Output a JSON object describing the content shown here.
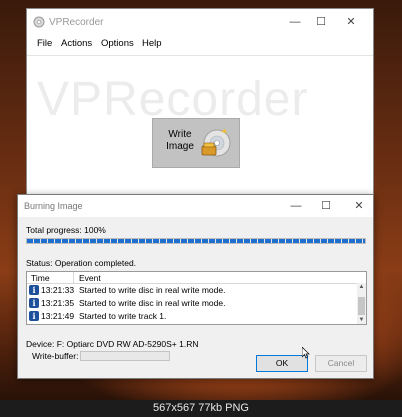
{
  "app": {
    "title": "VPRecorder",
    "watermark": "VPRecorder"
  },
  "menu": [
    "File",
    "Actions",
    "Options",
    "Help"
  ],
  "main": {
    "write_image_label": "Write Image"
  },
  "dialog": {
    "title": "Burning Image",
    "total_progress_label": "Total progress: 100%",
    "progress_fraction": 1.0,
    "status": "Status: Operation completed.",
    "log_columns": {
      "time": "Time",
      "event": "Event"
    },
    "log_rows": [
      {
        "time": "13:21:33",
        "event": "Started to write disc in real write mode."
      },
      {
        "time": "13:21:35",
        "event": "Started to write disc in real write mode."
      },
      {
        "time": "13:21:49",
        "event": "Started to write track 1."
      }
    ],
    "device": "Device: F: Optiarc DVD RW AD-5290S+ 1.RN",
    "write_buffer_label": "Write-buffer:",
    "ok_label": "OK",
    "cancel_label": "Cancel"
  },
  "caption": "567x567 77kb PNG",
  "colors": {
    "progress": "#1e6fd0",
    "info_icon": "#1d4f9a",
    "ok_border": "#0078d7"
  }
}
